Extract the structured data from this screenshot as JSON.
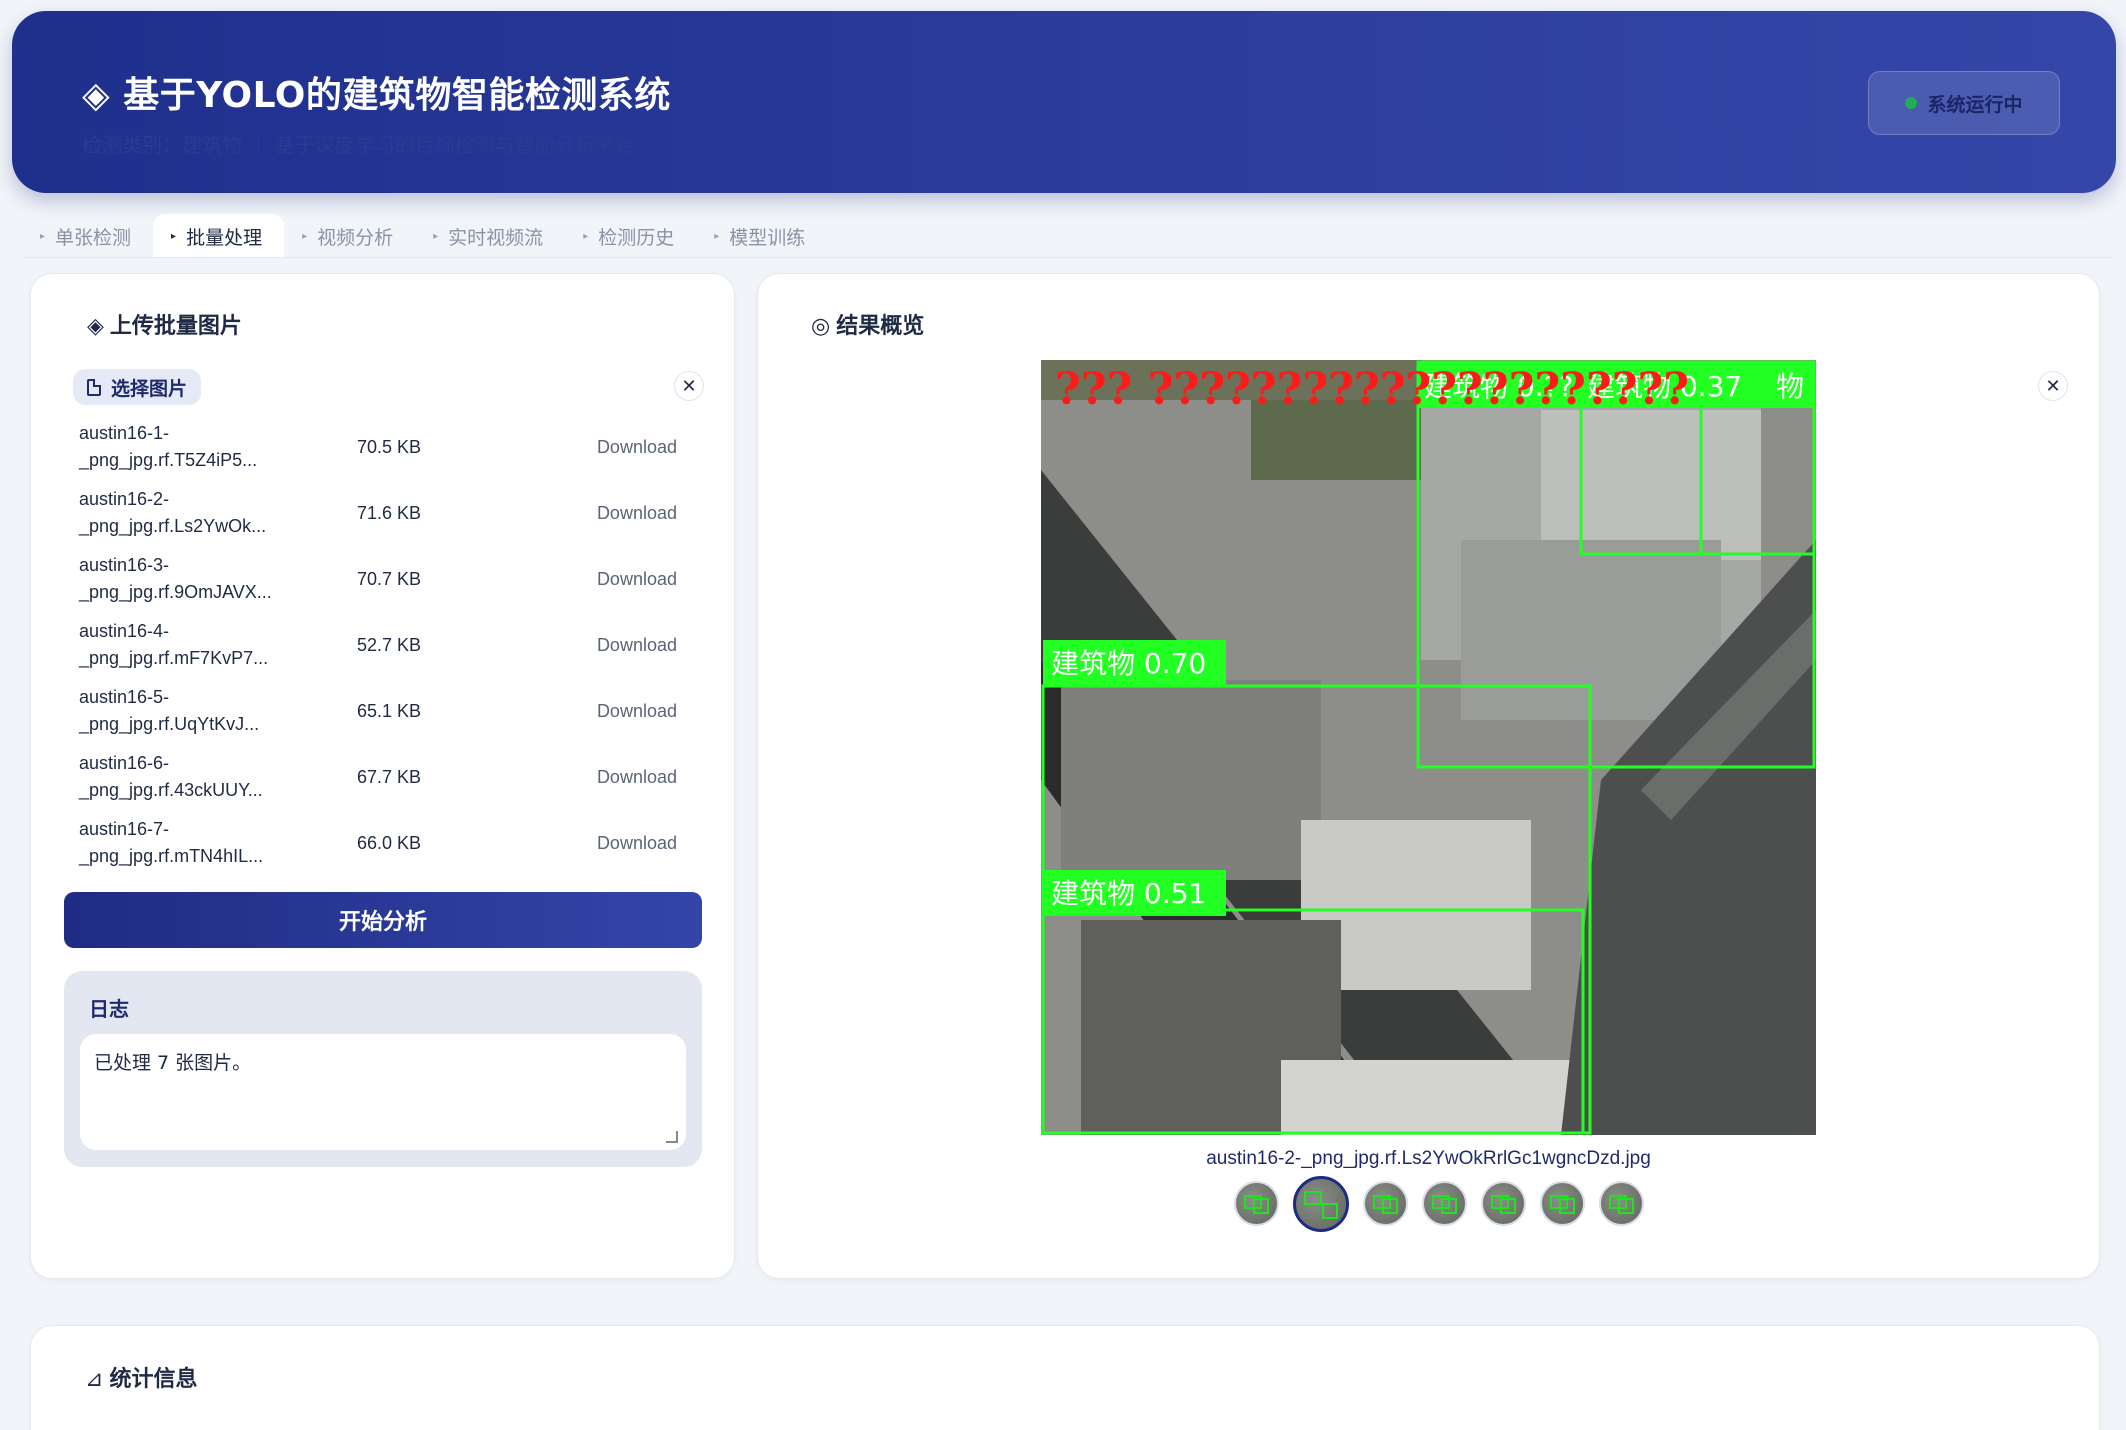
{
  "header": {
    "title": "◈ 基于YOLO的建筑物智能检测系统",
    "subtitle": "检测类别：建筑物 ｜ 基于深度学习的目标检测与智能分析平台",
    "status": "系统运行中"
  },
  "tabs": [
    {
      "label": "单张检测"
    },
    {
      "label": "批量处理"
    },
    {
      "label": "视频分析"
    },
    {
      "label": "实时视频流"
    },
    {
      "label": "检测历史"
    },
    {
      "label": "模型训练"
    }
  ],
  "upload": {
    "title": "上传批量图片",
    "title_icon": "◈",
    "select_label": "选择图片",
    "files": [
      {
        "name": "austin16-1-\n_png_jpg.rf.T5Z4iP5...",
        "size": "70.5 KB",
        "action": "Download"
      },
      {
        "name": "austin16-2-\n_png_jpg.rf.Ls2YwOk...",
        "size": "71.6 KB",
        "action": "Download"
      },
      {
        "name": "austin16-3-\n_png_jpg.rf.9OmJAVX...",
        "size": "70.7 KB",
        "action": "Download"
      },
      {
        "name": "austin16-4-\n_png_jpg.rf.mF7KvP7...",
        "size": "52.7 KB",
        "action": "Download"
      },
      {
        "name": "austin16-5-\n_png_jpg.rf.UqYtKvJ...",
        "size": "65.1 KB",
        "action": "Download"
      },
      {
        "name": "austin16-6-\n_png_jpg.rf.43ckUUY...",
        "size": "67.7 KB",
        "action": "Download"
      },
      {
        "name": "austin16-7-\n_png_jpg.rf.mTN4hIL...",
        "size": "66.0 KB",
        "action": "Download"
      }
    ],
    "analyze_button": "开始分析",
    "log_label": "日志",
    "log_text": "已处理 7 张图片。"
  },
  "result": {
    "title": "结果概览",
    "title_icon": "◎",
    "overlay_text": "???  ?????????????????????",
    "detections": [
      {
        "label": "建筑物 0.70"
      },
      {
        "label": "建筑物 0.51"
      },
      {
        "label": "建筑物 0.??"
      },
      {
        "label": "建筑物 0.37"
      },
      {
        "label": "物"
      }
    ],
    "caption": "austin16-2-_png_jpg.rf.Ls2YwOkRrlGc1wgncDzd.jpg",
    "thumbnail_count": 7,
    "active_thumbnail": 2
  },
  "stats": {
    "title": "统计信息",
    "title_icon": "⊿"
  },
  "colors": {
    "header_start": "#1f2f8c",
    "header_end": "#3447a8",
    "detection_box": "#22ff22",
    "overlay_text": "#ff1a1a",
    "status_dot": "#1fae52"
  }
}
